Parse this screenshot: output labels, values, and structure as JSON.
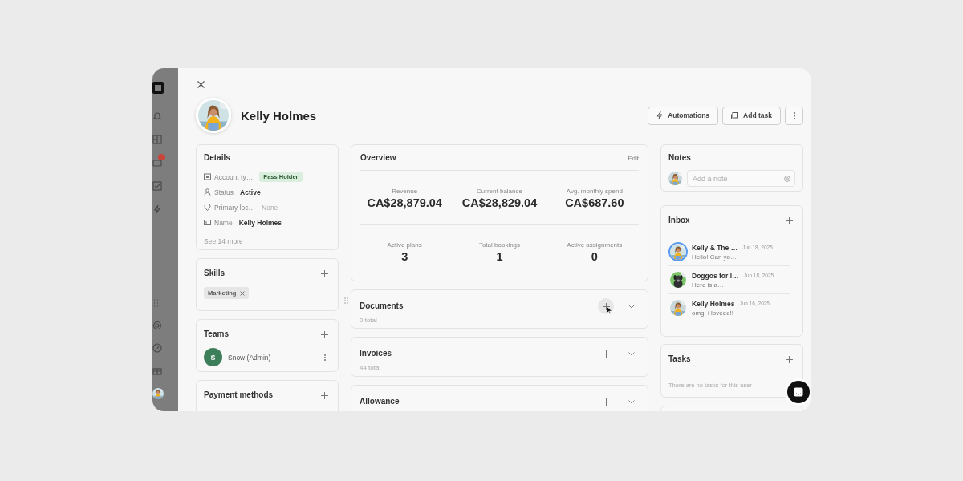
{
  "sidebar": {
    "badge": true
  },
  "profile": {
    "name": "Kelly Holmes"
  },
  "actions": [
    {
      "kind": "bolt",
      "label": "Automations"
    },
    {
      "kind": "task",
      "label": "Add task"
    },
    {
      "kind": "more"
    }
  ],
  "details": {
    "title": "Details",
    "fields": [
      {
        "kind": "tag",
        "label": "Account ty…",
        "value": "Pass Holder"
      },
      {
        "kind": "text",
        "label": "Status",
        "value": "Active",
        "muted": false
      },
      {
        "kind": "text",
        "label": "Primary loc…",
        "value": "None",
        "muted": true
      },
      {
        "kind": "text",
        "label": "Name",
        "value": "Kelly Holmes",
        "muted": false
      }
    ],
    "more": "See 14 more"
  },
  "skills": {
    "title": "Skills",
    "tags": [
      {
        "label": "Marketing"
      }
    ]
  },
  "teams": {
    "title": "Teams",
    "members": [
      {
        "initial": "S",
        "name": "Snow (Admin)"
      }
    ]
  },
  "payment_methods": {
    "title": "Payment methods"
  },
  "overview": {
    "title": "Overview",
    "edit": "Edit",
    "metrics": [
      {
        "label": "Revenue",
        "value": "CA$28,879.04"
      },
      {
        "label": "Current balance",
        "value": "CA$28,829.04"
      },
      {
        "label": "Avg. monthly spend",
        "value": "CA$687.60"
      }
    ],
    "counts": [
      {
        "label": "Active plans",
        "value": "3"
      },
      {
        "label": "Total bookings",
        "value": "1"
      },
      {
        "label": "Active assignments",
        "value": "0"
      }
    ]
  },
  "sections": [
    {
      "title": "Documents",
      "subtitle": "0 total",
      "hovered": true
    },
    {
      "title": "Invoices",
      "subtitle": "44 total",
      "hovered": false
    },
    {
      "title": "Allowance",
      "hovered": false
    }
  ],
  "notes": {
    "title": "Notes",
    "placeholder": "Add a note"
  },
  "inbox": {
    "title": "Inbox",
    "messages": [
      {
        "sender": "Kelly & The …",
        "date": "Jun 18, 2025",
        "preview": "Hello! Can yo…",
        "selected": true
      },
      {
        "sender": "Doggos for l…",
        "date": "Jun 18, 2025",
        "preview": "Here is a…",
        "selected": false
      },
      {
        "sender": "Kelly Holmes",
        "date": "Jun 16, 2025",
        "preview": "omg, i loveee!!",
        "selected": false
      }
    ]
  },
  "tasks": {
    "title": "Tasks",
    "empty": "There are no tasks for this user"
  }
}
